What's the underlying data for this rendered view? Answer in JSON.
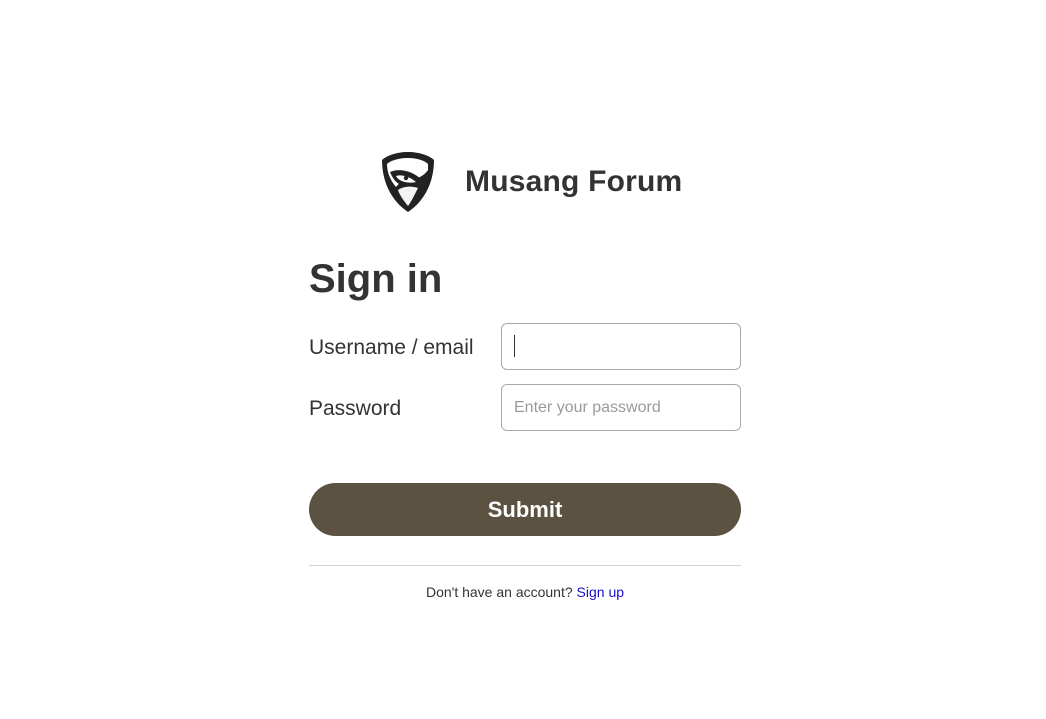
{
  "brand": {
    "logo_icon": "badger-shield-icon",
    "name": "Musang Forum"
  },
  "page": {
    "title": "Sign in"
  },
  "form": {
    "username_label": "Username / email",
    "username_value": "",
    "password_label": "Password",
    "password_placeholder": "Enter your password",
    "password_value": "",
    "submit_label": "Submit"
  },
  "footer": {
    "prompt": "Don't have an account?",
    "signup_link": "Sign up"
  },
  "colors": {
    "button_bg": "#5c5242",
    "button_text": "#ffffff",
    "link": "#1a0dcc",
    "text": "#333333"
  }
}
